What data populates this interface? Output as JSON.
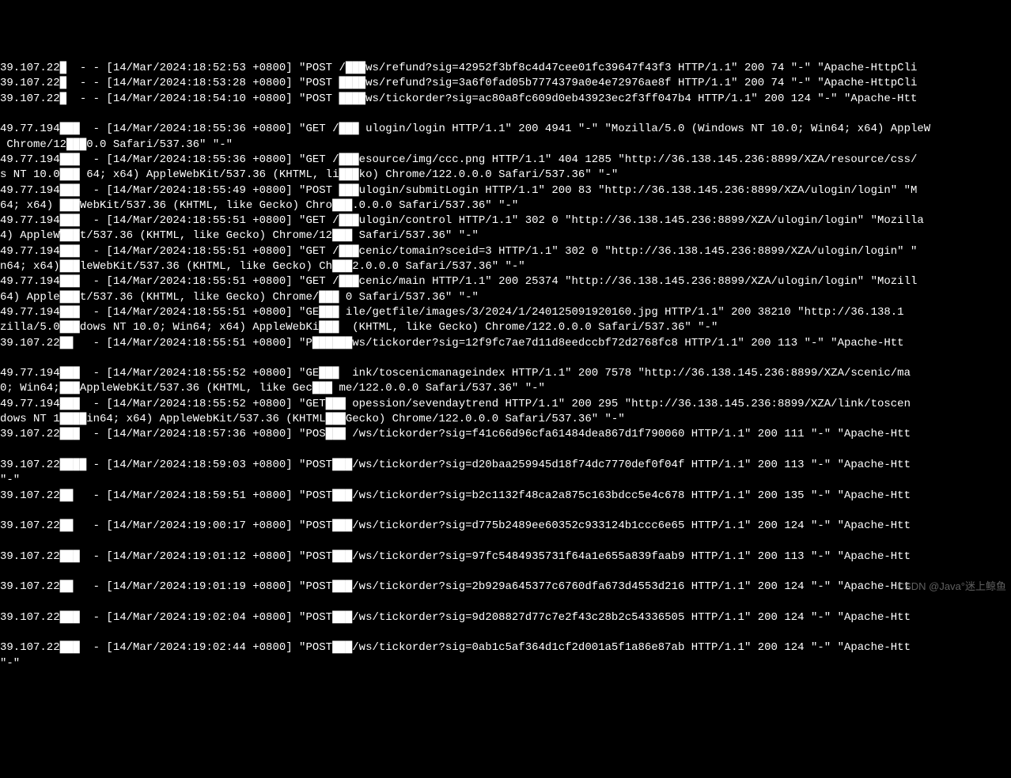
{
  "watermark": "CSDN @Java°迷上鲸鱼",
  "log_lines": [
    "39.107.22█  - - [14/Mar/2024:18:52:53 +0800] \"POST /███ws/refund?sig=42952f3bf8c4d47cee01fc39647f43f3 HTTP/1.1\" 200 74 \"-\" \"Apache-HttpCli",
    "39.107.22█  - - [14/Mar/2024:18:53:28 +0800] \"POST ████ws/refund?sig=3a6f0fad05b7774379a0e4e72976ae8f HTTP/1.1\" 200 74 \"-\" \"Apache-HttpCli",
    "39.107.22█  - - [14/Mar/2024:18:54:10 +0800] \"POST ████ws/tickorder?sig=ac80a8fc609d0eb43923ec2f3ff047b4 HTTP/1.1\" 200 124 \"-\" \"Apache-Htt",
    "",
    "49.77.194███  - [14/Mar/2024:18:55:36 +0800] \"GET /███ ulogin/login HTTP/1.1\" 200 4941 \"-\" \"Mozilla/5.0 (Windows NT 10.0; Win64; x64) AppleW",
    " Chrome/12███0.0 Safari/537.36\" \"-\"",
    "49.77.194███  - [14/Mar/2024:18:55:36 +0800] \"GET /███esource/img/ccc.png HTTP/1.1\" 404 1285 \"http://36.138.145.236:8899/XZA/resource/css/",
    "s NT 10.0███ 64; x64) AppleWebKit/537.36 (KHTML, li███ko) Chrome/122.0.0.0 Safari/537.36\" \"-\"",
    "49.77.194███  - [14/Mar/2024:18:55:49 +0800] \"POST ███ulogin/submitLogin HTTP/1.1\" 200 83 \"http://36.138.145.236:8899/XZA/ulogin/login\" \"M",
    "64; x64) ███WebKit/537.36 (KHTML, like Gecko) Chro███.0.0.0 Safari/537.36\" \"-\"",
    "49.77.194███  - [14/Mar/2024:18:55:51 +0800] \"GET /███ulogin/control HTTP/1.1\" 302 0 \"http://36.138.145.236:8899/XZA/ulogin/login\" \"Mozilla",
    "4) AppleW███t/537.36 (KHTML, like Gecko) Chrome/12███ Safari/537.36\" \"-\"",
    "49.77.194███  - [14/Mar/2024:18:55:51 +0800] \"GET /███cenic/tomain?sceid=3 HTTP/1.1\" 302 0 \"http://36.138.145.236:8899/XZA/ulogin/login\" \"",
    "n64; x64)███leWebKit/537.36 (KHTML, like Gecko) Ch███2.0.0.0 Safari/537.36\" \"-\"",
    "49.77.194███  - [14/Mar/2024:18:55:51 +0800] \"GET /███cenic/main HTTP/1.1\" 200 25374 \"http://36.138.145.236:8899/XZA/ulogin/login\" \"Mozill",
    "64) Apple███t/537.36 (KHTML, like Gecko) Chrome/███ 0 Safari/537.36\" \"-\"",
    "49.77.194███  - [14/Mar/2024:18:55:51 +0800] \"GE███ ile/getfile/images/3/2024/1/240125091920160.jpg HTTP/1.1\" 200 38210 \"http://36.138.1",
    "zilla/5.0███dows NT 10.0; Win64; x64) AppleWebKi███  (KHTML, like Gecko) Chrome/122.0.0.0 Safari/537.36\" \"-\"",
    "39.107.22██   - [14/Mar/2024:18:55:51 +0800] \"P██████ws/tickorder?sig=12f9fc7ae7d11d8eedccbf72d2768fc8 HTTP/1.1\" 200 113 \"-\" \"Apache-Htt",
    "",
    "49.77.194███  - [14/Mar/2024:18:55:52 +0800] \"GE███  ink/toscenicmanageindex HTTP/1.1\" 200 7578 \"http://36.138.145.236:8899/XZA/scenic/ma",
    "0; Win64;███AppleWebKit/537.36 (KHTML, like Gec███ me/122.0.0.0 Safari/537.36\" \"-\"",
    "49.77.194███  - [14/Mar/2024:18:55:52 +0800] \"GET███ opession/sevendaytrend HTTP/1.1\" 200 295 \"http://36.138.145.236:8899/XZA/link/toscen",
    "dows NT 1████in64; x64) AppleWebKit/537.36 (KHTML███Gecko) Chrome/122.0.0.0 Safari/537.36\" \"-\"",
    "39.107.22███  - [14/Mar/2024:18:57:36 +0800] \"POS███ /ws/tickorder?sig=f41c66d96cfa61484dea867d1f790060 HTTP/1.1\" 200 111 \"-\" \"Apache-Htt",
    "",
    "39.107.22████ - [14/Mar/2024:18:59:03 +0800] \"POST███/ws/tickorder?sig=d20baa259945d18f74dc7770def0f04f HTTP/1.1\" 200 113 \"-\" \"Apache-Htt",
    "\"-\"",
    "39.107.22██   - [14/Mar/2024:18:59:51 +0800] \"POST███/ws/tickorder?sig=b2c1132f48ca2a875c163bdcc5e4c678 HTTP/1.1\" 200 135 \"-\" \"Apache-Htt",
    "",
    "39.107.22██   - [14/Mar/2024:19:00:17 +0800] \"POST███/ws/tickorder?sig=d775b2489ee60352c933124b1ccc6e65 HTTP/1.1\" 200 124 \"-\" \"Apache-Htt",
    "",
    "39.107.22███  - [14/Mar/2024:19:01:12 +0800] \"POST███/ws/tickorder?sig=97fc5484935731f64a1e655a839faab9 HTTP/1.1\" 200 113 \"-\" \"Apache-Htt",
    "",
    "39.107.22██   - [14/Mar/2024:19:01:19 +0800] \"POST███/ws/tickorder?sig=2b929a645377c6760dfa673d4553d216 HTTP/1.1\" 200 124 \"-\" \"Apache-Htt",
    "",
    "39.107.22███  - [14/Mar/2024:19:02:04 +0800] \"POST███/ws/tickorder?sig=9d208827d77c7e2f43c28b2c54336505 HTTP/1.1\" 200 124 \"-\" \"Apache-Htt",
    "",
    "39.107.22███  - [14/Mar/2024:19:02:44 +0800] \"POST███/ws/tickorder?sig=0ab1c5af364d1cf2d001a5f1a86e87ab HTTP/1.1\" 200 124 \"-\" \"Apache-Htt",
    "\"-\""
  ]
}
